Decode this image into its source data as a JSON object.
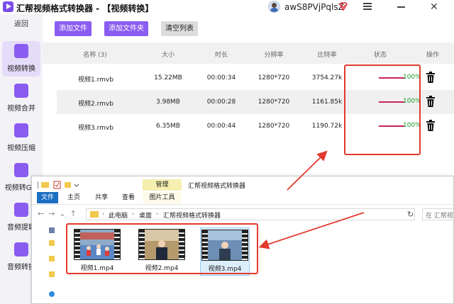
{
  "app": {
    "title": "汇帮视频格式转换器 - 【视频转换】",
    "username": "awS8PVjPqlsZ",
    "colors": {
      "accent": "#8a5cf0",
      "highlight": "#e23a2e",
      "progress": "#c8235f",
      "status_text": "#1a9a2a"
    }
  },
  "window_controls": {
    "menu_icon": "menu-icon",
    "minimize_icon": "minimize-icon",
    "close_icon": "close-icon"
  },
  "sidebar": {
    "back_label": "返回",
    "items": [
      {
        "label": "视频转换",
        "icon": "video-convert-icon",
        "active": true
      },
      {
        "label": "视频合并",
        "icon": "video-merge-icon",
        "active": false
      },
      {
        "label": "视频压缩",
        "icon": "video-compress-icon",
        "active": false
      },
      {
        "label": "视频转GIF",
        "icon": "gif-icon",
        "active": false
      },
      {
        "label": "音频提取",
        "icon": "music-note-icon",
        "active": false
      },
      {
        "label": "音频转换",
        "icon": "microphone-icon",
        "active": false
      }
    ]
  },
  "toolbar": {
    "add_file": "添加文件",
    "add_folder": "添加文件夹",
    "clear_list": "清空列表"
  },
  "table": {
    "headers": {
      "name": "名称 (3)",
      "size": "大小",
      "duration": "时长",
      "resolution": "分辨率",
      "bitrate": "比特率",
      "status": "状态",
      "action": "操作"
    },
    "rows": [
      {
        "name": "视频1.rmvb",
        "size": "15.22MB",
        "duration": "00:00:34",
        "resolution": "1280*720",
        "bitrate": "3754.27k",
        "status": "100%",
        "progress": 1.0
      },
      {
        "name": "视频2.rmvb",
        "size": "3.98MB",
        "duration": "00:00:28",
        "resolution": "1280*720",
        "bitrate": "1161.85k",
        "status": "100%",
        "progress": 1.0
      },
      {
        "name": "视频3.rmvb",
        "size": "6.35MB",
        "duration": "00:00:44",
        "resolution": "1280*720",
        "bitrate": "1190.72k",
        "status": "100%",
        "progress": 1.0
      }
    ]
  },
  "explorer": {
    "window_title": "汇帮视频格式转换器",
    "context_tab": "管理",
    "ribbon_tabs": {
      "file": "文件",
      "home": "主页",
      "share": "共享",
      "view": "查看",
      "picture_tools": "图片工具"
    },
    "breadcrumb": {
      "pc": "此电脑",
      "desktop": "桌面",
      "folder": "汇帮视频格式转换器"
    },
    "search_placeholder": "在 汇帮视",
    "files": [
      {
        "name": "视频1.mp4",
        "selected": false
      },
      {
        "name": "视频2.mp4",
        "selected": false
      },
      {
        "name": "视频3.mp4",
        "selected": true
      }
    ]
  }
}
